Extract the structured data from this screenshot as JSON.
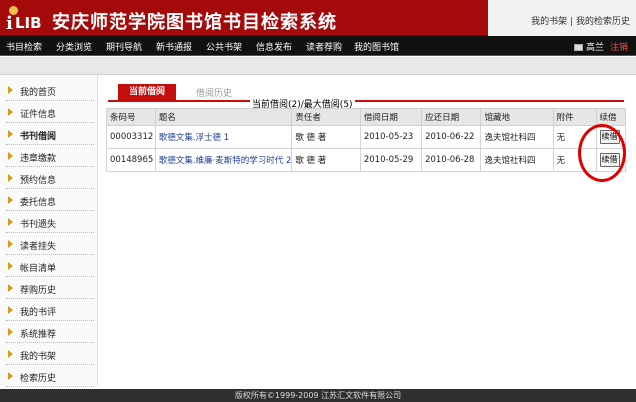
{
  "header": {
    "logo_text": "LIB",
    "logo_prefix": "i",
    "title": "安庆师范学院图书馆书目检索系统",
    "link_bookshelf": "我的书架",
    "link_sep": "|",
    "link_search_history": "我的检索历史"
  },
  "nav": {
    "items": [
      "书目检索",
      "分类浏览",
      "期刊导航",
      "新书通报",
      "公共书架",
      "信息发布",
      "读者荐购",
      "我的图书馆"
    ],
    "user_name": "高兰",
    "logout_label": "注销"
  },
  "sidebar": {
    "items": [
      "我的首页",
      "证件信息",
      "书刊借阅",
      "违章缴款",
      "预约信息",
      "委托信息",
      "书刊遗失",
      "读者挂失",
      "帐目清单",
      "荐购历史",
      "我的书评",
      "系统推荐",
      "我的书架",
      "检索历史"
    ],
    "active_index": 2
  },
  "tabs": {
    "current": "当前借阅",
    "history": "借阅历史"
  },
  "loan_summary": {
    "prefix": "当前借阅(",
    "current": "2",
    "middle": ")/最大借阅(",
    "max": "5",
    "suffix": ")"
  },
  "table": {
    "headers": [
      "条码号",
      "题名",
      "责任者",
      "借阅日期",
      "应还日期",
      "馆藏地",
      "附件",
      "续借"
    ],
    "rows": [
      {
        "barcode": "00003312",
        "title": "歌德文集.浮士德 1",
        "author": "歌 德 著",
        "borrow_date": "2010-05-23",
        "due_date": "2010-06-22",
        "location": "逸夫馆社科四",
        "attachment": "无",
        "renew_label": "续借"
      },
      {
        "barcode": "00148965",
        "title": "歌德文集.维廉·麦斯特的学习时代 2",
        "author": "歌 德 著",
        "borrow_date": "2010-05-29",
        "due_date": "2010-06-28",
        "location": "逸夫馆社科四",
        "attachment": "无",
        "renew_label": "续借"
      }
    ]
  },
  "footer": {
    "copyright": "版权所有©1999-2009 江苏汇文软件有限公司"
  },
  "colors": {
    "brand_red": "#a40a0a",
    "tab_red": "#c40d0d",
    "highlight": "#e00000",
    "link_blue": "#1f3f9a"
  }
}
